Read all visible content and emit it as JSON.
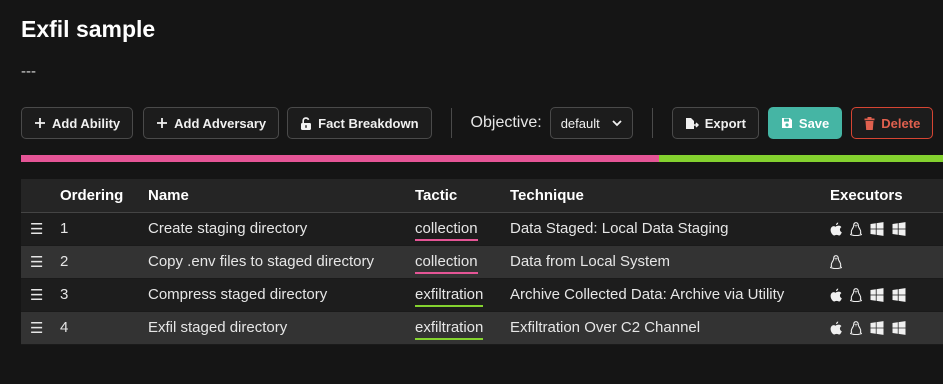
{
  "adversary": {
    "name": "Exfil sample",
    "description": "---"
  },
  "toolbar": {
    "add_ability_label": "Add Ability",
    "add_adversary_label": "Add Adversary",
    "fact_breakdown_label": "Fact Breakdown",
    "objective_label": "Objective:",
    "objective_value": "default",
    "export_label": "Export",
    "save_label": "Save",
    "delete_label": "Delete"
  },
  "tactic_colors": {
    "collection": "#e55596",
    "exfiltration": "#84d22f"
  },
  "table": {
    "headers": {
      "ordering": "Ordering",
      "name": "Name",
      "tactic": "Tactic",
      "technique": "Technique",
      "executors": "Executors"
    },
    "rows": [
      {
        "ordering": "1",
        "name": "Create staging directory",
        "tactic": "collection",
        "technique": "Data Staged: Local Data Staging",
        "executors": [
          "apple-icon",
          "linux-icon",
          "windows-icon",
          "windows-icon"
        ]
      },
      {
        "ordering": "2",
        "name": "Copy .env files to staged directory",
        "tactic": "collection",
        "technique": "Data from Local System",
        "executors": [
          "linux-icon"
        ]
      },
      {
        "ordering": "3",
        "name": "Compress staged directory",
        "tactic": "exfiltration",
        "technique": "Archive Collected Data: Archive via Utility",
        "executors": [
          "apple-icon",
          "linux-icon",
          "windows-icon",
          "windows-icon"
        ]
      },
      {
        "ordering": "4",
        "name": "Exfil staged directory",
        "tactic": "exfiltration",
        "technique": "Exfiltration Over C2 Channel",
        "executors": [
          "apple-icon",
          "linux-icon",
          "windows-icon",
          "windows-icon"
        ]
      }
    ]
  }
}
